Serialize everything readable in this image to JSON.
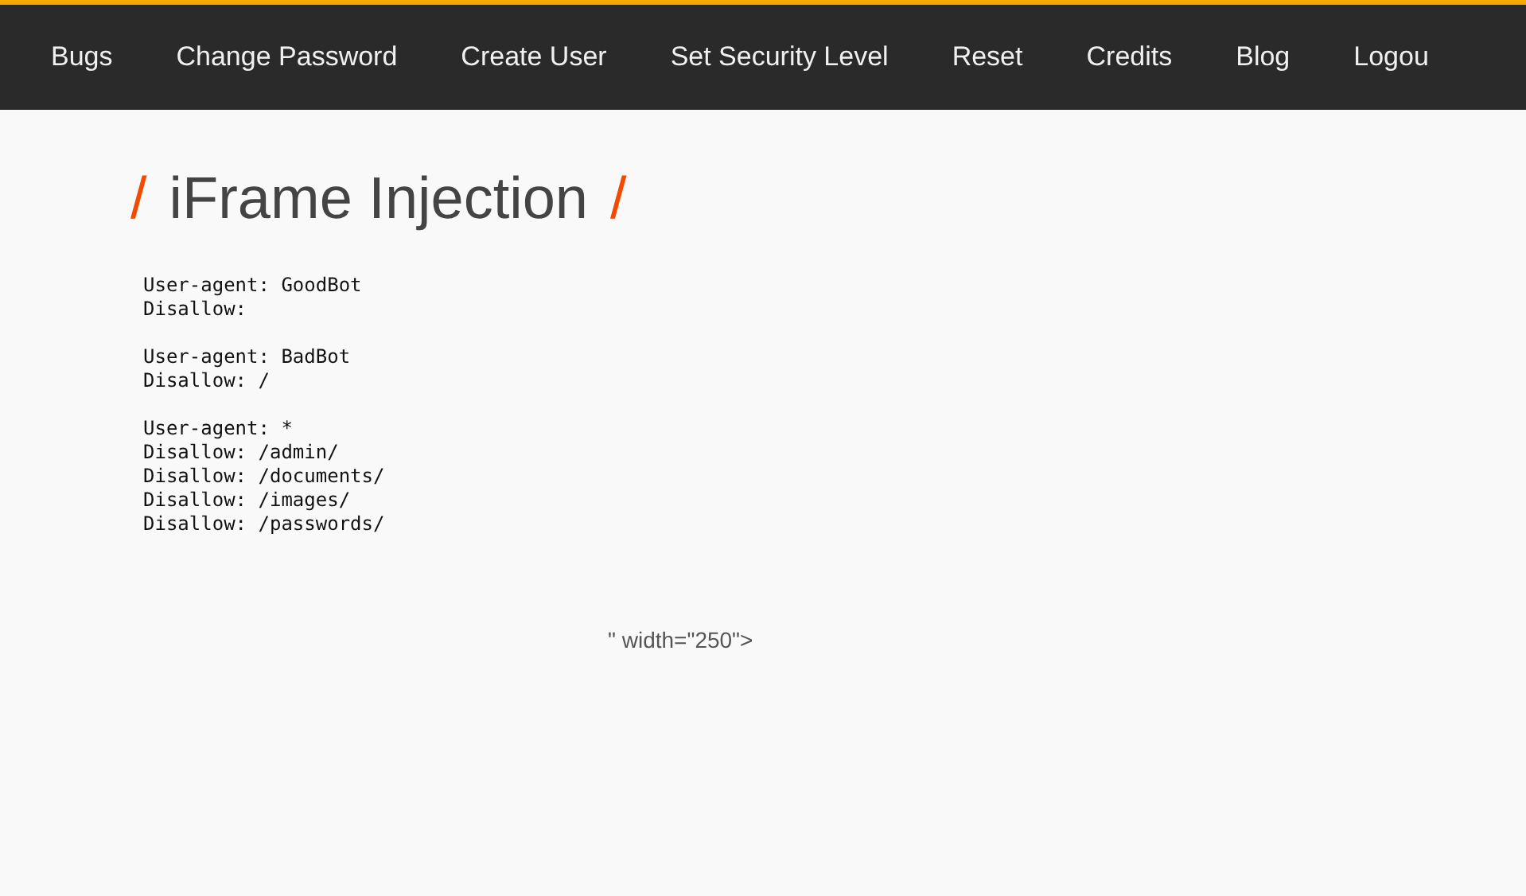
{
  "menu": [
    {
      "label": "Bugs"
    },
    {
      "label": "Change Password"
    },
    {
      "label": "Create User"
    },
    {
      "label": "Set Security Level"
    },
    {
      "label": "Reset"
    },
    {
      "label": "Credits"
    },
    {
      "label": "Blog"
    },
    {
      "label": "Logou"
    }
  ],
  "heading": {
    "prefix": "/",
    "text": "iFrame Injection",
    "suffix": "/"
  },
  "robots_blocks": [
    [
      "User-agent: GoodBot",
      "Disallow:"
    ],
    [
      "User-agent: BadBot",
      "Disallow: /"
    ],
    [
      "User-agent: *",
      "Disallow: /admin/",
      "Disallow: /documents/",
      "Disallow: /images/",
      "Disallow: /passwords/"
    ]
  ],
  "leftover_text": "\" width=\"250\">"
}
